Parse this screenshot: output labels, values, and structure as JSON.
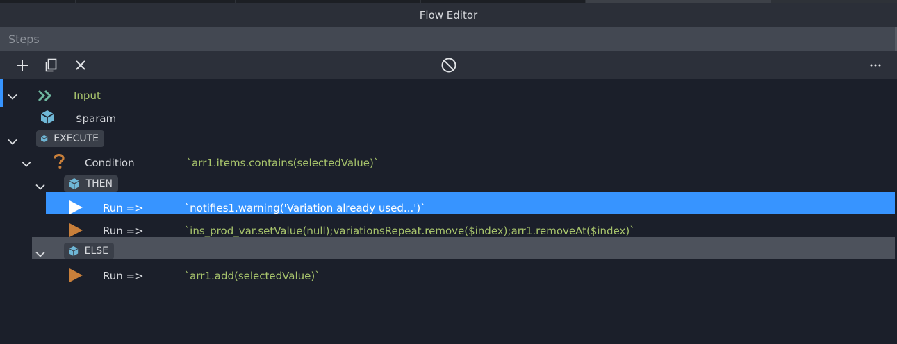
{
  "window": {
    "title": "Flow Editor"
  },
  "panel": {
    "title": "Steps"
  },
  "toolbar": {
    "add_icon": "plus-icon",
    "copy_icon": "copy-icon",
    "delete_icon": "close-icon",
    "disable_icon": "disable-icon",
    "more_icon": "more-horizontal-icon"
  },
  "tree": {
    "input": {
      "label": "Input"
    },
    "param": {
      "label": "$param"
    },
    "execute": {
      "label": "EXECUTE"
    },
    "condition": {
      "keyword": "Condition",
      "expr": "`arr1.items.contains(selectedValue)`"
    },
    "then": {
      "label": "THEN"
    },
    "run1": {
      "keyword": "Run =>",
      "expr": "`notifies1.warning('Variation already used...')`"
    },
    "run2": {
      "keyword": "Run =>",
      "expr": "`ins_prod_var.setValue(null);variationsRepeat.remove($index);arr1.removeAt($index)`"
    },
    "else": {
      "label": "ELSE"
    },
    "run3": {
      "keyword": "Run =>",
      "expr": "`arr1.add(selectedValue)`"
    }
  },
  "colors": {
    "background": "#1b1f2a",
    "selection": "#3794ff",
    "hover_row": "#4d525c",
    "keyword_green": "#a8c46c",
    "run_orange": "#c87f3a",
    "cube_teal": "#6fb7d6"
  }
}
